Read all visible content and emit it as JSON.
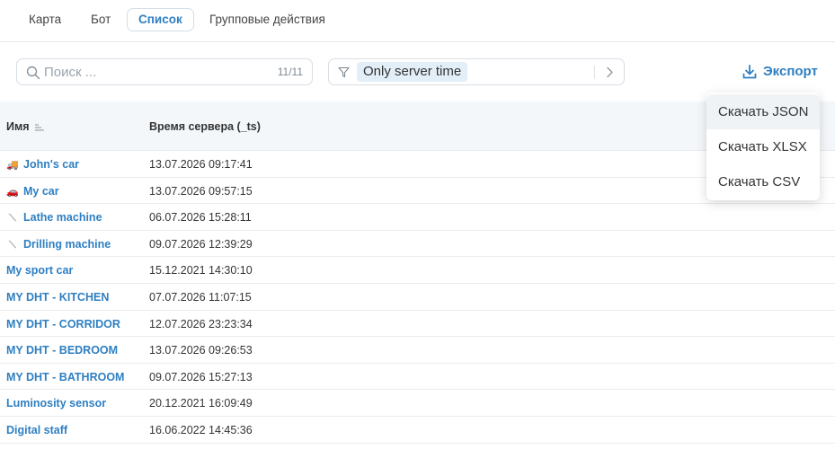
{
  "tabs": [
    {
      "label": "Карта"
    },
    {
      "label": "Бот"
    },
    {
      "label": "Список"
    },
    {
      "label": "Групповые действия"
    }
  ],
  "search": {
    "placeholder": "Поиск ...",
    "count": "11/11"
  },
  "filter": {
    "chip": "Only server time"
  },
  "export": {
    "label": "Экспорт"
  },
  "export_menu": {
    "items": [
      {
        "label": "Скачать JSON"
      },
      {
        "label": "Скачать XLSX"
      },
      {
        "label": "Скачать CSV"
      }
    ]
  },
  "table": {
    "columns": [
      "Имя",
      "Время сервера (_ts)"
    ],
    "rows": [
      {
        "icon": "truck-icon",
        "glyph": "🚚",
        "name": "John's car",
        "time": "13.07.2026 09:17:41"
      },
      {
        "icon": "car-icon",
        "glyph": "🚗",
        "name": "My car",
        "time": "13.07.2026 09:57:15"
      },
      {
        "icon": "wrench-icon",
        "glyph": "⟍",
        "name": "Lathe machine",
        "time": "06.07.2026 15:28:11"
      },
      {
        "icon": "wrench-icon",
        "glyph": "⟍",
        "name": "Drilling machine",
        "time": "09.07.2026 12:39:29"
      },
      {
        "icon": "",
        "glyph": "",
        "name": "My sport car",
        "time": "15.12.2021 14:30:10"
      },
      {
        "icon": "",
        "glyph": "",
        "name": "MY DHT - KITCHEN",
        "time": "07.07.2026 11:07:15"
      },
      {
        "icon": "",
        "glyph": "",
        "name": "MY DHT - CORRIDOR",
        "time": "12.07.2026 23:23:34"
      },
      {
        "icon": "",
        "glyph": "",
        "name": "MY DHT - BEDROOM",
        "time": "13.07.2026 09:26:53"
      },
      {
        "icon": "",
        "glyph": "",
        "name": "MY DHT - BATHROOM",
        "time": "09.07.2026 15:27:13"
      },
      {
        "icon": "",
        "glyph": "",
        "name": "Luminosity sensor",
        "time": "20.12.2021 16:09:49"
      },
      {
        "icon": "",
        "glyph": "",
        "name": "Digital staff",
        "time": "16.06.2022 14:45:36"
      }
    ]
  },
  "colors": {
    "accent": "#2e7fc2",
    "chip_bg": "#e3eff8",
    "header_bg": "#f4f7fa"
  }
}
